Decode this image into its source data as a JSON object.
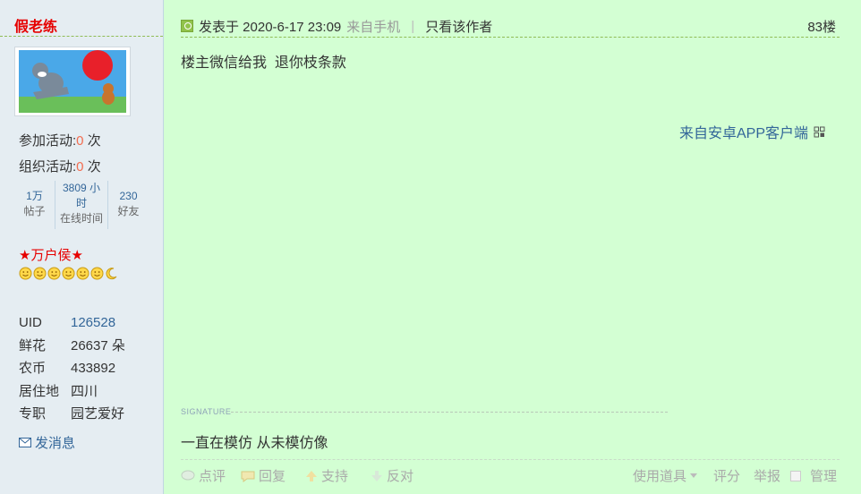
{
  "author": {
    "name": "假老练",
    "activities": [
      {
        "label": "参加活动:",
        "value": "0",
        "unit": "次"
      },
      {
        "label": "组织活动:",
        "value": "0",
        "unit": "次"
      }
    ],
    "stats": [
      {
        "value": "1万",
        "label": "帖子"
      },
      {
        "value": "3809 小时",
        "label": "在线时间"
      },
      {
        "value": "230",
        "label": "好友"
      }
    ],
    "rank": "★万户侯★",
    "info": [
      {
        "key": "UID",
        "value": "126528"
      },
      {
        "key": "鲜花",
        "value": "26637 朵"
      },
      {
        "key": "农币",
        "value": "433892"
      },
      {
        "key": "居住地",
        "value": "四川"
      },
      {
        "key": "专职",
        "value": "园艺爱好"
      }
    ],
    "send_message": "发消息"
  },
  "post": {
    "posted_at": "发表于 2020-6-17 23:09",
    "source": "来自手机",
    "separator": "|",
    "author_only": "只看该作者",
    "floor": "83楼",
    "content": "楼主微信给我  退你枝条款",
    "app_source": "来自安卓APP客户端",
    "signature_label": "SIGNATURE",
    "signature": "一直在模仿 从未模仿像"
  },
  "actions": {
    "comment": "点评",
    "reply": "回复",
    "support": "支持",
    "oppose": "反对",
    "tools": "使用道具",
    "rate": "评分",
    "report": "举报",
    "manage": "管理"
  },
  "colors": {
    "post_bg": "#d3ffd3",
    "sidebar_bg": "#e5edf2",
    "author_name": "#e60000",
    "link": "#336699"
  }
}
